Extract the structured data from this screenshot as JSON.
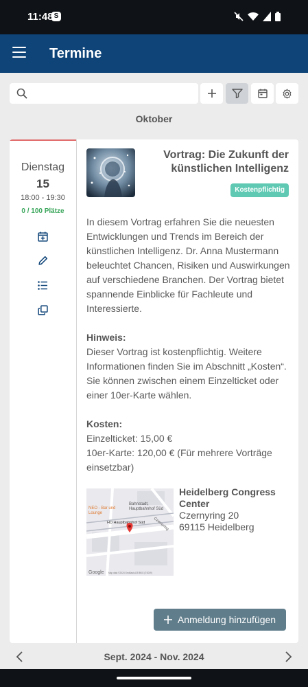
{
  "status_bar": {
    "time": "11:48",
    "app_badge": "S"
  },
  "app_bar": {
    "title": "Termine"
  },
  "search": {
    "placeholder": "",
    "value": ""
  },
  "toolbar": {
    "add_icon": "plus-icon",
    "filter_icon": "filter-icon",
    "calendar_icon": "calendar-icon",
    "settings_icon": "gear-icon",
    "filter_active": true
  },
  "month_label": "Oktober",
  "event": {
    "weekday": "Dienstag",
    "day": "15",
    "time_range": "18:00 - 19:30",
    "places": "0 / 100 Plätze",
    "title": "Vortrag: Die Zukunft der künstlichen Intelligenz",
    "badge": "Kostenpflichtig",
    "description": "In diesem Vortrag erfahren Sie die neuesten Entwicklungen und Trends im Bereich der künstlichen Intelligenz. Dr. Anna Mustermann beleuchtet Chancen, Risiken und Auswirkungen auf verschiedene Branchen. Der Vortrag bietet spannende Einblicke für Fachleute und Interessierte.",
    "hint_heading": "Hinweis:",
    "hint_text": "Dieser Vortrag ist kostenpflichtig. Weitere Informationen finden Sie im Abschnitt „Kosten“. Sie können zwischen einem Einzelticket oder einer 10er-Karte wählen.",
    "costs_heading": "Kosten:",
    "cost_single": "Einzelticket: 15,00 €",
    "cost_ten": "10er-Karte: 120,00 € (Für mehrere Vorträge einsetzbar)",
    "location_name": "Heidelberg Congress Center",
    "location_street": "Czernyring 20",
    "location_city": "69115 Heidelberg",
    "add_button_label": "Anmeldung hinzufügen",
    "map_labels": {
      "bahnstadt": "Bahnstadt,",
      "hbf_sued": "Hauptbahnhof Süd",
      "hd_hbf_sued": "HD Hauptbahnhof Süd",
      "neo": "NEO - Bar und",
      "neo_line2": "Lounge",
      "czernyring": "Czernyring",
      "google": "Google",
      "attribution": "Map data ©2024 GeoBasis-DE/BKG (©2009)"
    }
  },
  "bottom_nav": {
    "range": "Sept. 2024 - Nov. 2024"
  },
  "colors": {
    "app_bar": "#0e4478",
    "badge": "#5fc9b3",
    "places": "#3aa65b",
    "button": "#607d8b",
    "accent_line": "#e26c6c"
  }
}
